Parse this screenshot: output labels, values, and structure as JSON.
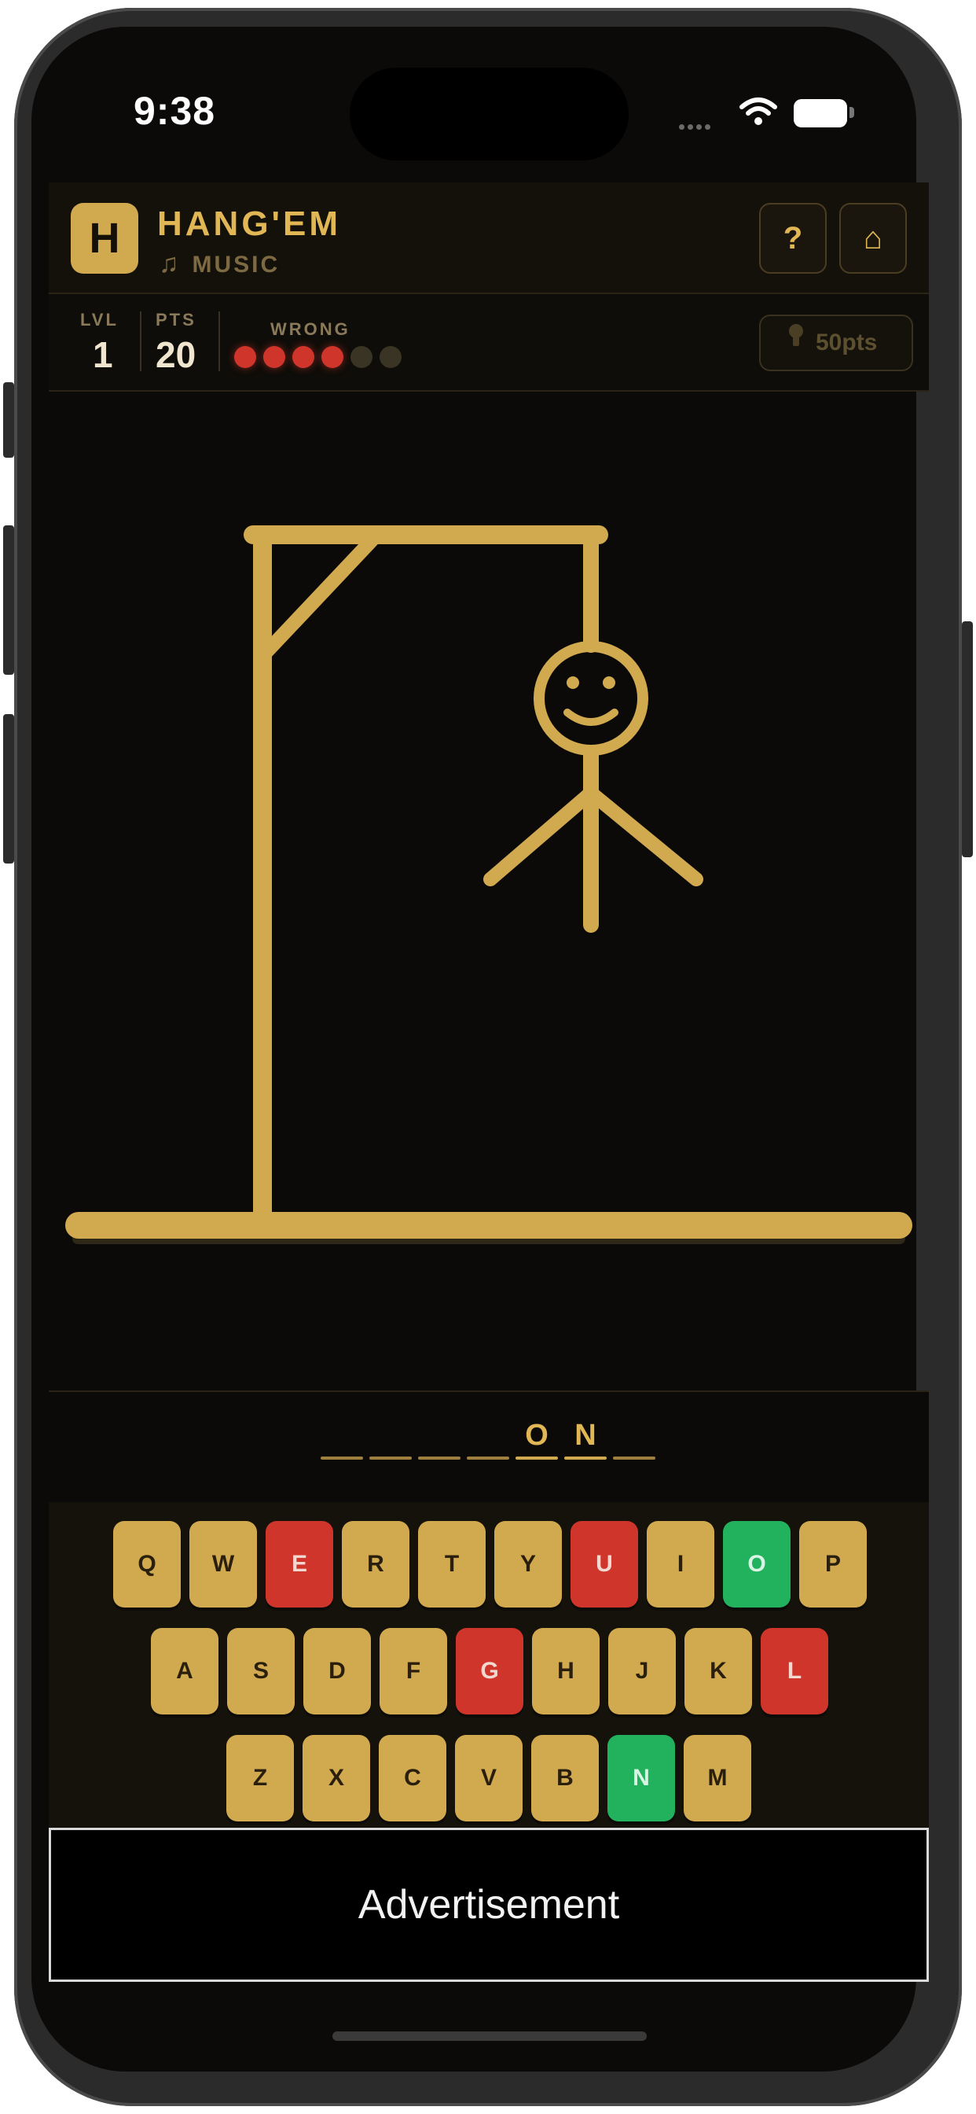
{
  "status_bar": {
    "time": "9:38"
  },
  "header": {
    "logo_letter": "H",
    "title": "HANG'EM",
    "category": "MUSIC",
    "help_label": "?",
    "home_label": "⌂"
  },
  "stats": {
    "level_label": "LVL",
    "level_value": "1",
    "points_label": "PTS",
    "points_value": "20",
    "wrong_label": "WRONG",
    "wrong_count": 4,
    "wrong_max": 6,
    "hint_label": "50pts"
  },
  "word": {
    "slots": [
      "",
      "",
      "",
      "",
      "O",
      "N",
      ""
    ]
  },
  "keyboard": {
    "rows": [
      [
        {
          "letter": "Q",
          "state": "unused"
        },
        {
          "letter": "W",
          "state": "unused"
        },
        {
          "letter": "E",
          "state": "wrong"
        },
        {
          "letter": "R",
          "state": "unused"
        },
        {
          "letter": "T",
          "state": "unused"
        },
        {
          "letter": "Y",
          "state": "unused"
        },
        {
          "letter": "U",
          "state": "wrong"
        },
        {
          "letter": "I",
          "state": "unused"
        },
        {
          "letter": "O",
          "state": "correct"
        },
        {
          "letter": "P",
          "state": "unused"
        }
      ],
      [
        {
          "letter": "A",
          "state": "unused"
        },
        {
          "letter": "S",
          "state": "unused"
        },
        {
          "letter": "D",
          "state": "unused"
        },
        {
          "letter": "F",
          "state": "unused"
        },
        {
          "letter": "G",
          "state": "wrong"
        },
        {
          "letter": "H",
          "state": "unused"
        },
        {
          "letter": "J",
          "state": "unused"
        },
        {
          "letter": "K",
          "state": "unused"
        },
        {
          "letter": "L",
          "state": "wrong"
        }
      ],
      [
        {
          "letter": "Z",
          "state": "unused"
        },
        {
          "letter": "X",
          "state": "unused"
        },
        {
          "letter": "C",
          "state": "unused"
        },
        {
          "letter": "V",
          "state": "unused"
        },
        {
          "letter": "B",
          "state": "unused"
        },
        {
          "letter": "N",
          "state": "correct"
        },
        {
          "letter": "M",
          "state": "unused"
        }
      ]
    ]
  },
  "advertisement": {
    "label": "Advertisement"
  },
  "colors": {
    "gold": "#d1a94f",
    "wrong": "#d0352c",
    "correct": "#22b25d",
    "background": "#0c0a09"
  },
  "icons": {
    "category": "music-note-icon",
    "hint": "lightbulb-icon",
    "help": "question-icon",
    "home": "home-icon"
  }
}
